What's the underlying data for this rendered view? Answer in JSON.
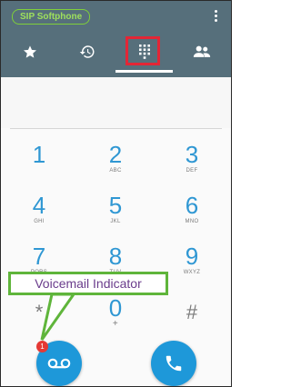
{
  "app": {
    "title": "SIP Softphone"
  },
  "tabs": [
    {
      "name": "favorites",
      "icon": "star-icon",
      "active": false
    },
    {
      "name": "history",
      "icon": "history-icon",
      "active": false
    },
    {
      "name": "dialpad",
      "icon": "dialpad-icon",
      "active": true
    },
    {
      "name": "contacts",
      "icon": "contacts-icon",
      "active": false
    }
  ],
  "dialpad": {
    "keys": [
      {
        "digit": "1",
        "letters": ""
      },
      {
        "digit": "2",
        "letters": "ABC"
      },
      {
        "digit": "3",
        "letters": "DEF"
      },
      {
        "digit": "4",
        "letters": "GHI"
      },
      {
        "digit": "5",
        "letters": "JKL"
      },
      {
        "digit": "6",
        "letters": "MNO"
      },
      {
        "digit": "7",
        "letters": "PQRS"
      },
      {
        "digit": "8",
        "letters": "TUV"
      },
      {
        "digit": "9",
        "letters": "WXYZ"
      },
      {
        "digit": "*",
        "letters": ""
      },
      {
        "digit": "0",
        "letters": "+"
      },
      {
        "digit": "#",
        "letters": ""
      }
    ]
  },
  "voicemail": {
    "badge_count": "1",
    "icon": "voicemail-icon"
  },
  "call": {
    "icon": "phone-icon"
  },
  "annotation": {
    "callout_text": "Voicemail Indicator",
    "border_color": "#5fb53b",
    "text_color": "#6a3c8c"
  },
  "colors": {
    "appbar": "#566f7b",
    "accent": "#1e98d9",
    "highlight": "#e32636"
  }
}
